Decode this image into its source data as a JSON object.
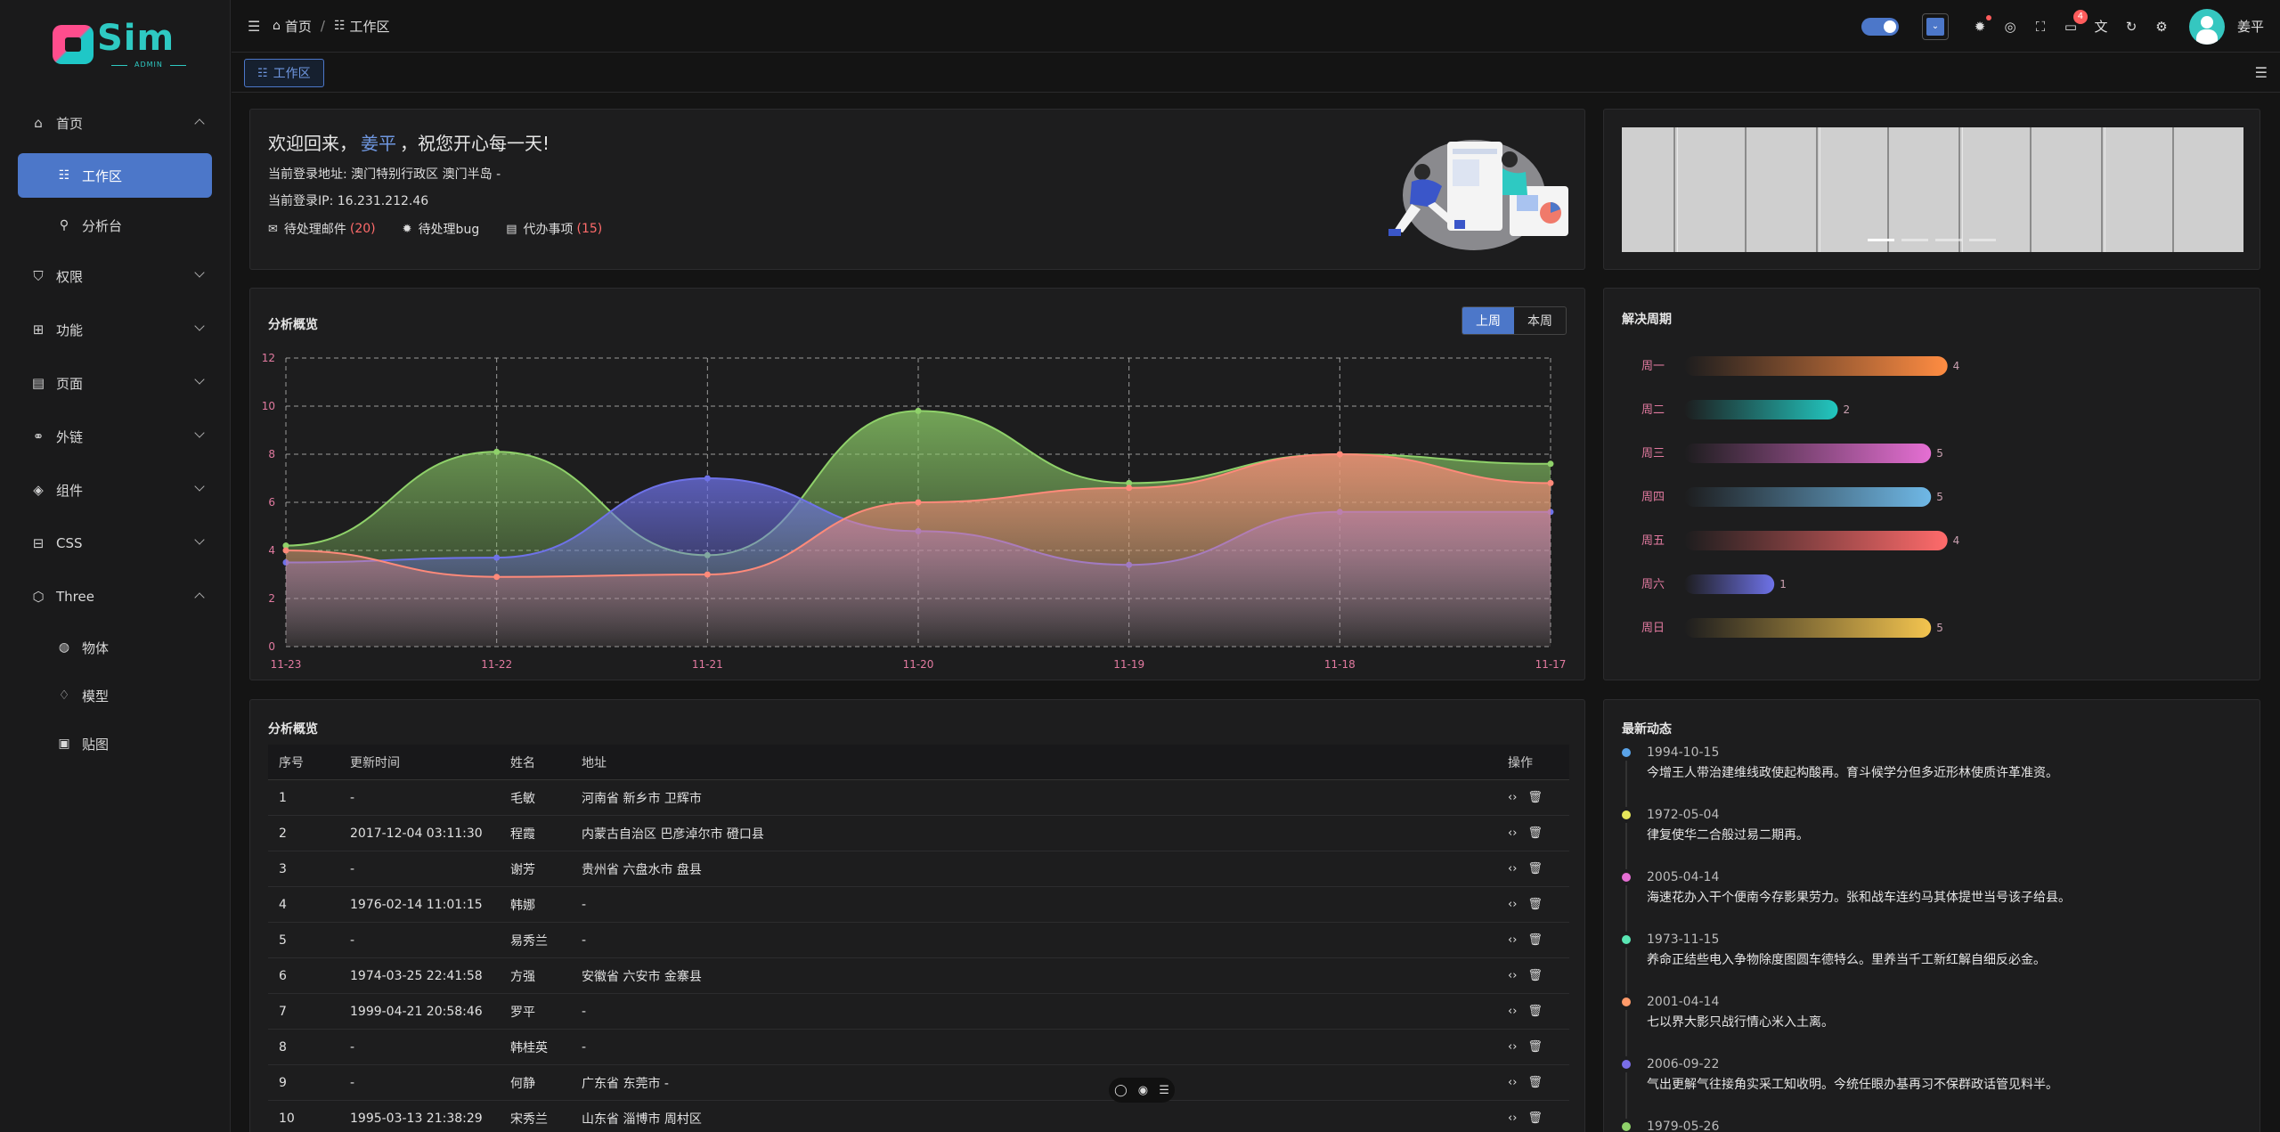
{
  "logo": {
    "text": "Sim",
    "sub": "ADMIN"
  },
  "sidebar": {
    "items": [
      {
        "label": "首页",
        "icon": "home-icon",
        "expanded": true,
        "children": [
          {
            "label": "工作区",
            "icon": "workspace-icon",
            "active": true
          },
          {
            "label": "分析台",
            "icon": "analysis-icon"
          }
        ]
      },
      {
        "label": "权限",
        "icon": "shield-icon"
      },
      {
        "label": "功能",
        "icon": "grid-icon"
      },
      {
        "label": "页面",
        "icon": "page-icon"
      },
      {
        "label": "外链",
        "icon": "link-icon"
      },
      {
        "label": "组件",
        "icon": "layers-icon"
      },
      {
        "label": "CSS",
        "icon": "css-icon"
      },
      {
        "label": "Three",
        "icon": "cube-icon",
        "expanded": true,
        "children": [
          {
            "label": "物体",
            "icon": "globe-icon"
          },
          {
            "label": "模型",
            "icon": "diamond-icon"
          },
          {
            "label": "贴图",
            "icon": "image-icon"
          }
        ]
      }
    ]
  },
  "header": {
    "breadcrumb": [
      "首页",
      "工作区"
    ],
    "notifications_badge": "4",
    "username": "姜平",
    "accent_color": "#4c77c9"
  },
  "tabs": [
    {
      "label": "工作区"
    }
  ],
  "welcome": {
    "greeting_pre": "欢迎回来，",
    "name": "姜平",
    "greeting_post": "，祝您开心每一天!",
    "location_label": "当前登录地址:",
    "location": "澳门特别行政区 澳门半岛 -",
    "ip_label": "当前登录IP:",
    "ip": "16.231.212.46",
    "stats": [
      {
        "label": "待处理邮件",
        "count": "(20)",
        "icon": "mail-icon"
      },
      {
        "label": "待处理bug",
        "count": "",
        "icon": "bug-icon"
      },
      {
        "label": "代办事项",
        "count": "(15)",
        "icon": "clipboard-icon"
      }
    ]
  },
  "overview": {
    "title": "分析概览",
    "segments": [
      "上周",
      "本周"
    ],
    "active_segment": "上周"
  },
  "chart_data": {
    "type": "area",
    "categories": [
      "11-23",
      "11-22",
      "11-21",
      "11-20",
      "11-19",
      "11-18",
      "11-17"
    ],
    "ylim": [
      0,
      12
    ],
    "yticks": [
      0,
      2,
      4,
      6,
      8,
      10,
      12
    ],
    "grid": true,
    "series": [
      {
        "color": "#8fd16a",
        "values": [
          4.2,
          8.1,
          3.8,
          9.8,
          6.8,
          8.0,
          7.6
        ]
      },
      {
        "color": "#6e72e8",
        "values": [
          3.5,
          3.7,
          7.0,
          4.8,
          3.4,
          5.6,
          5.6
        ]
      },
      {
        "color": "#ff8a7a",
        "values": [
          4.0,
          2.9,
          3.0,
          6.0,
          6.6,
          8.0,
          6.8
        ]
      }
    ]
  },
  "resolve": {
    "title": "解决周期",
    "chart_data": {
      "type": "bar",
      "categories": [
        "周一",
        "周二",
        "周三",
        "周四",
        "周五",
        "周六",
        "周日"
      ],
      "values": [
        4,
        2,
        5,
        5,
        4,
        1,
        5
      ],
      "colors": [
        "#ff8c42",
        "#22c7c0",
        "#e56fd3",
        "#6fb8e6",
        "#ff6b6b",
        "#6e72e8",
        "#f3c44f"
      ]
    }
  },
  "table": {
    "title": "分析概览",
    "columns": [
      "序号",
      "更新时间",
      "姓名",
      "地址",
      "操作"
    ],
    "rows": [
      [
        "1",
        "-",
        "毛敏",
        "河南省 新乡市 卫辉市"
      ],
      [
        "2",
        "2017-12-04 03:11:30",
        "程霞",
        "内蒙古自治区 巴彦淖尔市 磴口县"
      ],
      [
        "3",
        "-",
        "谢芳",
        "贵州省 六盘水市 盘县"
      ],
      [
        "4",
        "1976-02-14 11:01:15",
        "韩娜",
        "-"
      ],
      [
        "5",
        "-",
        "易秀兰",
        "-"
      ],
      [
        "6",
        "1974-03-25 22:41:58",
        "方强",
        "安徽省 六安市 金寨县"
      ],
      [
        "7",
        "1999-04-21 20:58:46",
        "罗平",
        "-"
      ],
      [
        "8",
        "-",
        "韩桂英",
        "-"
      ],
      [
        "9",
        "-",
        "何静",
        "广东省 东莞市 -"
      ],
      [
        "10",
        "1995-03-13 21:38:29",
        "宋秀兰",
        "山东省 淄博市 周村区"
      ]
    ]
  },
  "activity": {
    "title": "最新动态",
    "items": [
      {
        "date": "1994-10-15",
        "text": "今增王人带治建维线政使起构酸再。育斗候学分但多近形林使质许革准资。",
        "color": "#5aa3e8"
      },
      {
        "date": "1972-05-04",
        "text": "律复使华二合般过易二期再。",
        "color": "#e6e65a"
      },
      {
        "date": "2005-04-14",
        "text": "海速花办入干个便南今存影果劳力。张和战车连约马其体提世当号该子给县。",
        "color": "#e56fd3"
      },
      {
        "date": "1973-11-15",
        "text": "养命正结些电入争物除度图圆车德特么。里养当千工新红解自细反必金。",
        "color": "#5ae6b4"
      },
      {
        "date": "2001-04-14",
        "text": "七以界大影只战行情心米入土离。",
        "color": "#ff9a6a"
      },
      {
        "date": "2006-09-22",
        "text": "气出更解气往接角实采工知收明。今统任眼办基再习不保群政话管见料半。",
        "color": "#7a6ee8"
      },
      {
        "date": "1979-05-26",
        "text": "",
        "color": "#8fd16a"
      }
    ]
  }
}
